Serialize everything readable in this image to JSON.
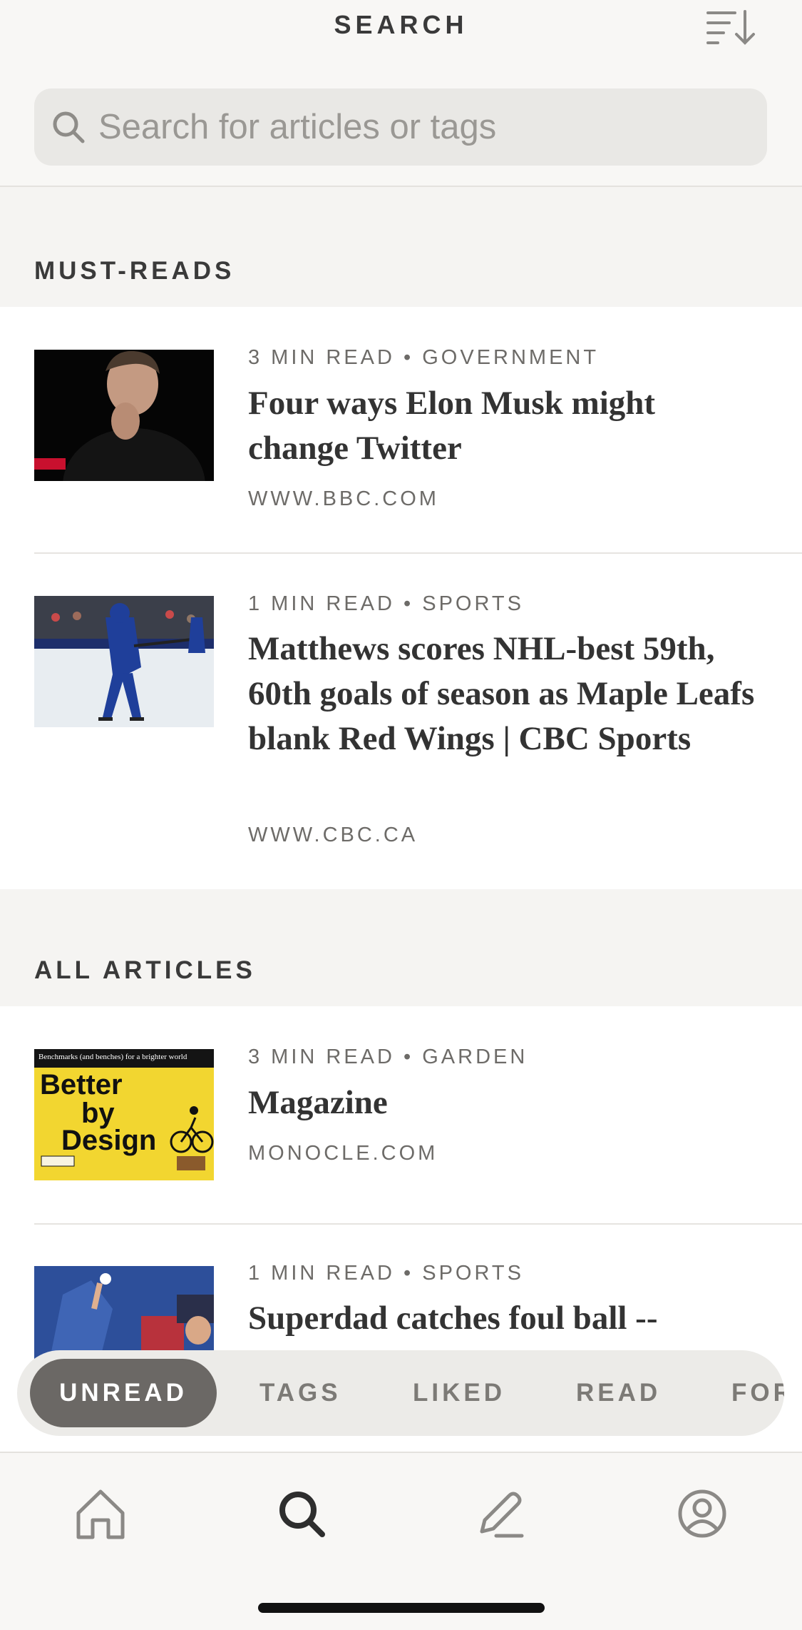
{
  "header": {
    "title": "SEARCH",
    "sort_icon": "sort-descending-icon"
  },
  "search": {
    "placeholder": "Search for articles or tags",
    "value": "",
    "icon": "search-icon"
  },
  "sections": {
    "must_reads": {
      "title": "MUST-READS",
      "articles": [
        {
          "meta": "3 MIN READ • GOVERNMENT",
          "title": "Four ways Elon Musk might change Twitter",
          "source": "WWW.BBC.COM",
          "thumbnail": "news-photo-thumbnail"
        },
        {
          "meta": "1 MIN READ • SPORTS",
          "title": "Matthews scores NHL-best 59th, 60th goals of season as Maple Leafs blank Red Wings | CBC Sports",
          "source": "WWW.CBC.CA",
          "thumbnail": "hockey-photo-thumbnail"
        }
      ]
    },
    "all_articles": {
      "title": "ALL ARTICLES",
      "articles": [
        {
          "meta": "3 MIN READ • GARDEN",
          "title": "Magazine",
          "source": "MONOCLE.COM",
          "thumbnail": "magazine-cover-thumbnail",
          "cover": {
            "top_line": "Benchmarks (and benches) for a brighter world",
            "headline_1": "Better",
            "headline_2": "by",
            "headline_3": "Design"
          }
        },
        {
          "meta": "1 MIN READ • SPORTS",
          "title": "Superdad catches foul ball --",
          "source": "",
          "thumbnail": "baseball-photo-thumbnail"
        }
      ]
    }
  },
  "filters": [
    {
      "label": "UNREAD",
      "active": true
    },
    {
      "label": "TAGS",
      "active": false
    },
    {
      "label": "LIKED",
      "active": false
    },
    {
      "label": "READ",
      "active": false
    },
    {
      "label": "FOR",
      "active": false
    }
  ],
  "bottom_nav": [
    {
      "icon": "home-icon",
      "active": false
    },
    {
      "icon": "search-icon",
      "active": true
    },
    {
      "icon": "pen-icon",
      "active": false
    },
    {
      "icon": "profile-icon",
      "active": false
    }
  ],
  "colors": {
    "background": "#f5f4f2",
    "card": "#ffffff",
    "active_chip": "#6b6865",
    "text_primary": "#333333",
    "text_secondary": "#6d6b68",
    "magazine_yellow": "#f2d630"
  }
}
